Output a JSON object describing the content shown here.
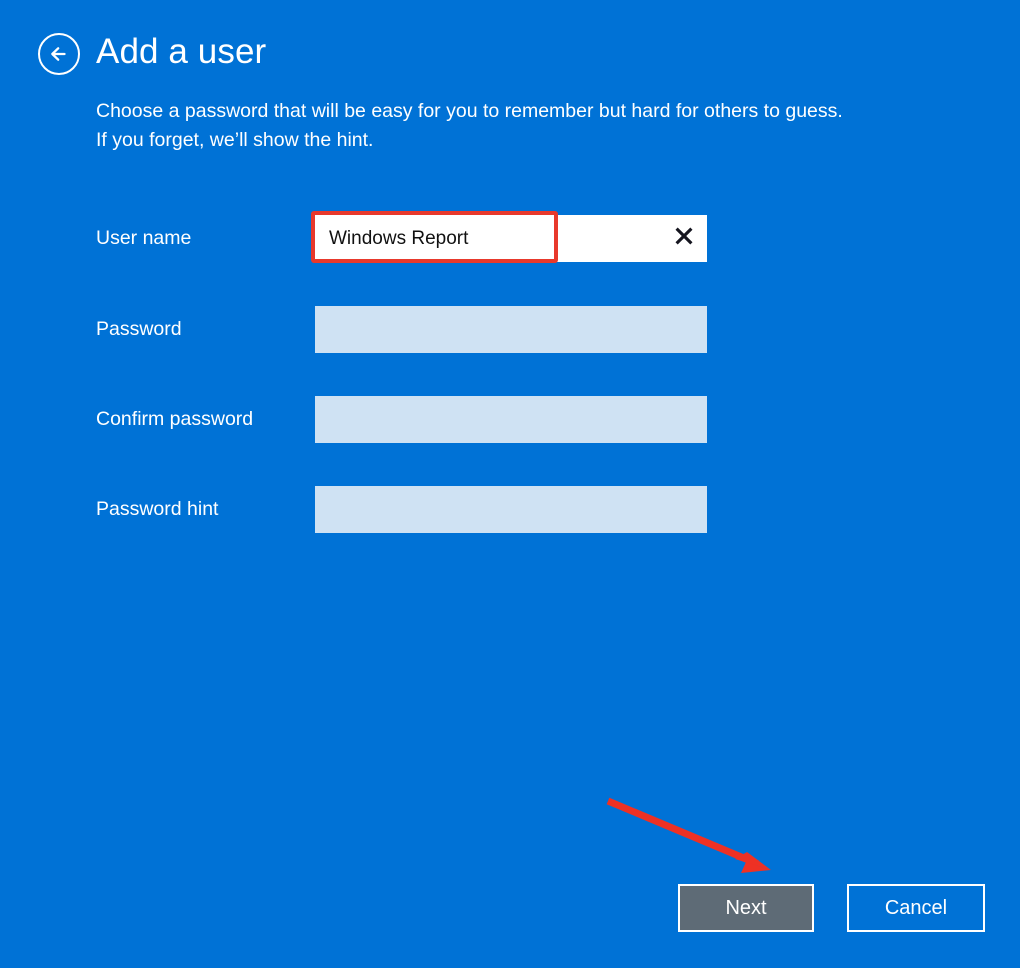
{
  "window": {
    "background_color": "#0072d6",
    "title": "Add a user",
    "back_icon": "back-arrow-circle-icon"
  },
  "header": {
    "title": "Add a user",
    "subtitle_line_1": "Choose a password that will be easy for you to remember but hard for others to guess.",
    "subtitle_line_2": "If you forget, we’ll show the hint."
  },
  "form": {
    "fields": [
      {
        "label": "User name",
        "value": "Windows Report",
        "placeholder": "",
        "type": "text",
        "filled": true,
        "clear_icon": "close-x-icon",
        "has_clear_button": true
      },
      {
        "label": "Password",
        "value": "",
        "placeholder": "",
        "type": "password",
        "filled": false,
        "has_clear_button": false
      },
      {
        "label": "Confirm password",
        "value": "",
        "placeholder": "",
        "type": "password",
        "filled": false,
        "has_clear_button": false
      },
      {
        "label": "Password hint",
        "value": "",
        "placeholder": "",
        "type": "text",
        "filled": false,
        "has_clear_button": false
      }
    ],
    "empty_field_color": "#cfe2f3",
    "filled_field_color": "#ffffff"
  },
  "footer": {
    "next_label": "Next",
    "cancel_label": "Cancel",
    "next_fill_color": "#5e6b76",
    "button_border_color": "#ffffff"
  },
  "annotations": {
    "highlight_color": "#e8392c",
    "arrow_color": "#ee3124",
    "highlight_target": "User name",
    "arrow_target": "Next"
  }
}
